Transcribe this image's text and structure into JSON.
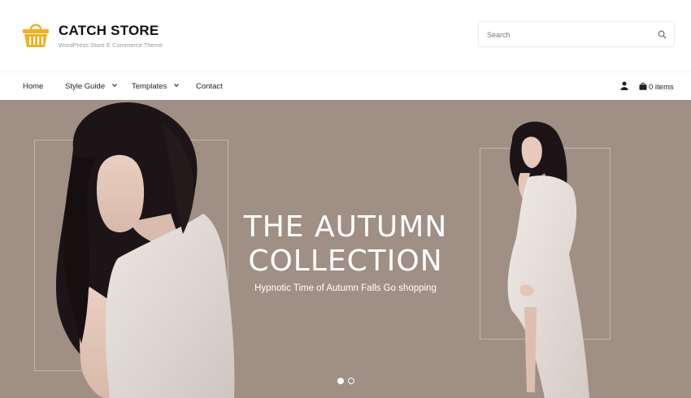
{
  "header": {
    "site_title": "CATCH STORE",
    "tagline": "WordPress Store E Commerce Theme",
    "search_placeholder": "Search"
  },
  "nav": {
    "items": [
      {
        "label": "Home",
        "has_dropdown": false
      },
      {
        "label": "Style Guide",
        "has_dropdown": true
      },
      {
        "label": "Templates",
        "has_dropdown": true
      },
      {
        "label": "Contact",
        "has_dropdown": false
      }
    ],
    "cart_label": "0 items",
    "icons": [
      "user-icon",
      "shopping-bag-icon",
      "chevron-down-icon",
      "search-icon",
      "basket-icon"
    ]
  },
  "hero": {
    "title_line1": "THE AUTUMN",
    "title_line2": "COLLECTION",
    "subtitle": "Hypnotic Time of Autumn Falls Go shopping",
    "slide_count": 2,
    "active_slide": 1
  },
  "colors": {
    "accent": "#f2b01e",
    "hero_bg": "#a08f84",
    "text": "#111111"
  }
}
